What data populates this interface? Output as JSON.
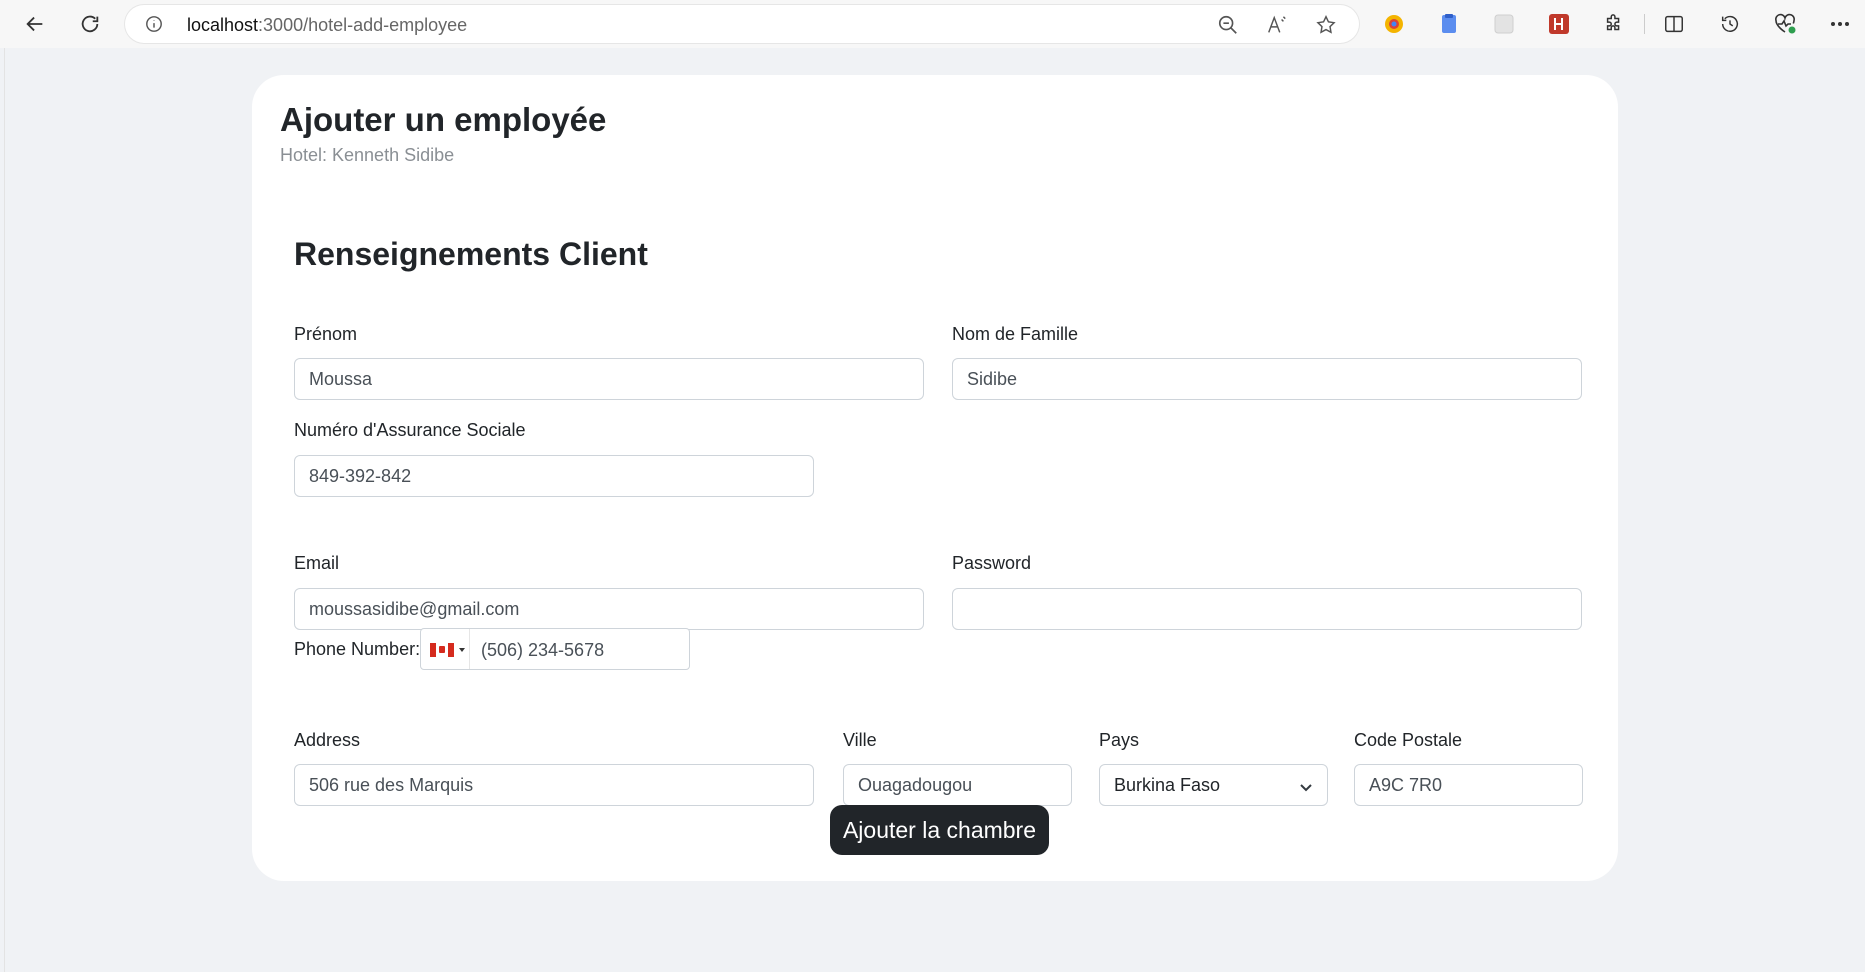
{
  "browser": {
    "url_host": "localhost",
    "url_path": ":3000/hotel-add-employee"
  },
  "page": {
    "title": "Ajouter un employée",
    "subtitle": "Hotel: Kenneth Sidibe",
    "section_title": "Renseignements Client"
  },
  "form": {
    "first_name": {
      "label": "Prénom",
      "value": "Moussa"
    },
    "last_name": {
      "label": "Nom de Famille",
      "value": "Sidibe"
    },
    "sin": {
      "label": "Numéro d'Assurance Sociale",
      "value": "849-392-842"
    },
    "email": {
      "label": "Email",
      "value": "moussasidibe@gmail.com"
    },
    "password": {
      "label": "Password",
      "value": ""
    },
    "phone": {
      "label": "Phone Number:",
      "value": "(506) 234-5678",
      "country": "CA"
    },
    "address": {
      "label": "Address",
      "value": "506 rue des Marquis"
    },
    "city": {
      "label": "Ville",
      "value": "Ouagadougou"
    },
    "country": {
      "label": "Pays",
      "selected": "Burkina Faso"
    },
    "postal_code": {
      "label": "Code Postale",
      "value": "A9C 7R0"
    },
    "submit_label": "Ajouter la chambre"
  }
}
